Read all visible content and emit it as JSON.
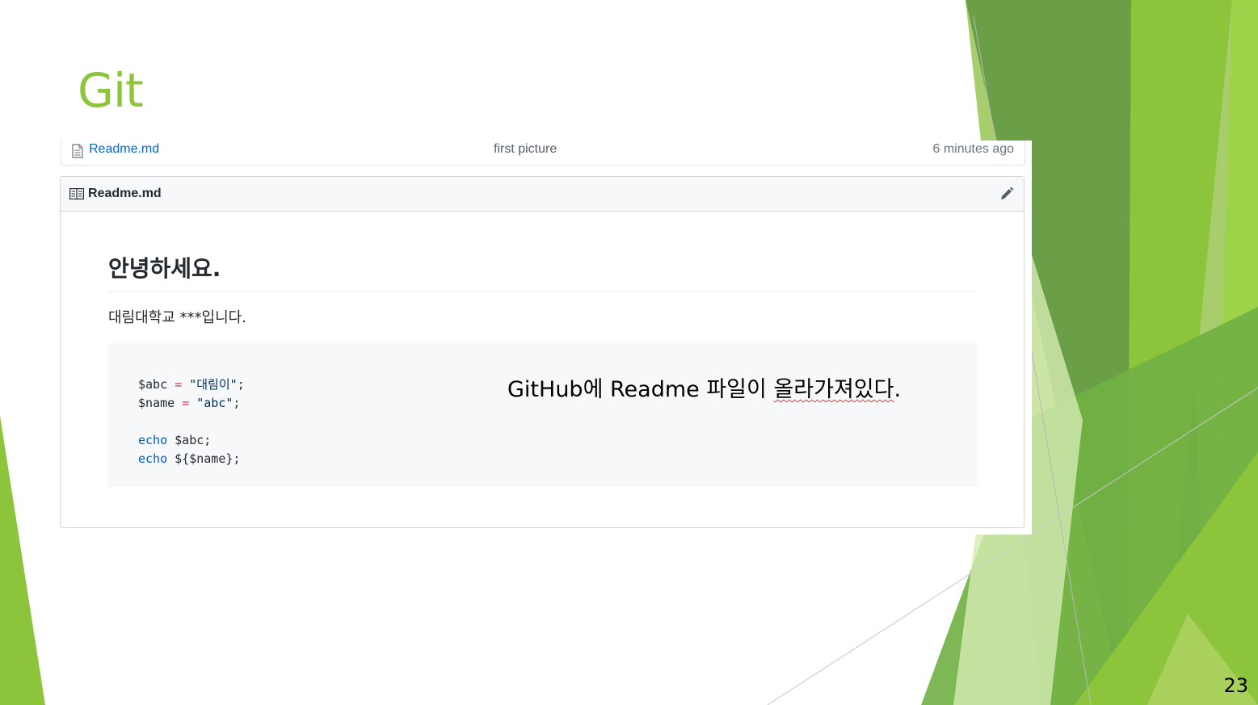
{
  "slide": {
    "title": "Git",
    "page_number": "23",
    "caption_prefix": "GitHub에 Readme 파일이 ",
    "caption_underlined": "올라가져있다",
    "caption_suffix": "."
  },
  "file_row": {
    "file_name": "Readme.md",
    "commit_message": "first picture",
    "age": "6 minutes ago"
  },
  "readme": {
    "header_title": "Readme.md",
    "heading": "안녕하세요.",
    "paragraph": "대림대학교 ***입니다.",
    "code": {
      "line1_var": "$abc",
      "line1_op": "=",
      "line1_str": "\"대림이\"",
      "line1_end": ";",
      "line2_var": "$name",
      "line2_op": "=",
      "line2_str": "\"abc\"",
      "line2_end": ";",
      "line4_kw": "echo",
      "line4_rest": "$abc;",
      "line5_kw": "echo",
      "line5_rest": "${$name};"
    }
  },
  "icons": {
    "file": "file-icon",
    "book": "book-icon",
    "edit": "pencil-icon"
  },
  "colors": {
    "title_green": "#8cc43c",
    "link_blue": "#0366d6",
    "code_bg": "#f6f8fa"
  }
}
